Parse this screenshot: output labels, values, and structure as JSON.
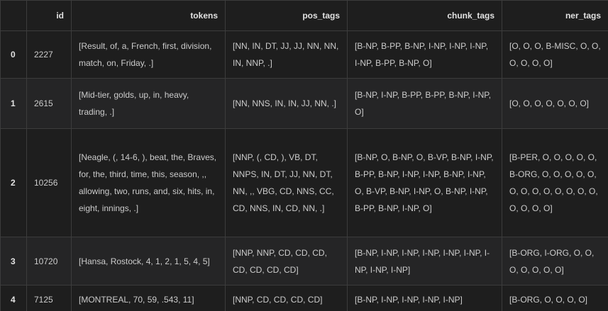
{
  "table": {
    "columns": [
      "",
      "id",
      "tokens",
      "pos_tags",
      "chunk_tags",
      "ner_tags"
    ],
    "rows": [
      {
        "index": "0",
        "id": "2227",
        "tokens": "[Result, of, a, French, first, division, match, on, Friday, .]",
        "pos_tags": "[NN, IN, DT, JJ, JJ, NN, NN, IN, NNP, .]",
        "chunk_tags": "[B-NP, B-PP, B-NP, I-NP, I-NP, I-NP, I-NP, B-PP, B-NP, O]",
        "ner_tags": "[O, O, O, B-MISC, O, O, O, O, O, O]"
      },
      {
        "index": "1",
        "id": "2615",
        "tokens": "[Mid-tier, golds, up, in, heavy, trading, .]",
        "pos_tags": "[NN, NNS, IN, IN, JJ, NN, .]",
        "chunk_tags": "[B-NP, I-NP, B-PP, B-PP, B-NP, I-NP, O]",
        "ner_tags": "[O, O, O, O, O, O, O]"
      },
      {
        "index": "2",
        "id": "10256",
        "tokens": "[Neagle, (, 14-6, ), beat, the, Braves, for, the, third, time, this, season, ,, allowing, two, runs, and, six, hits, in, eight, innings, .]",
        "pos_tags": "[NNP, (, CD, ), VB, DT, NNPS, IN, DT, JJ, NN, DT, NN, ,, VBG, CD, NNS, CC, CD, NNS, IN, CD, NN, .]",
        "chunk_tags": "[B-NP, O, B-NP, O, B-VP, B-NP, I-NP, B-PP, B-NP, I-NP, I-NP, B-NP, I-NP, O, B-VP, B-NP, I-NP, O, B-NP, I-NP, B-PP, B-NP, I-NP, O]",
        "ner_tags": "[B-PER, O, O, O, O, O, B-ORG, O, O, O, O, O, O, O, O, O, O, O, O, O, O, O, O, O]"
      },
      {
        "index": "3",
        "id": "10720",
        "tokens": "[Hansa, Rostock, 4, 1, 2, 1, 5, 4, 5]",
        "pos_tags": "[NNP, NNP, CD, CD, CD, CD, CD, CD, CD]",
        "chunk_tags": "[B-NP, I-NP, I-NP, I-NP, I-NP, I-NP, I-NP, I-NP, I-NP]",
        "ner_tags": "[B-ORG, I-ORG, O, O, O, O, O, O, O]"
      },
      {
        "index": "4",
        "id": "7125",
        "tokens": "[MONTREAL, 70, 59, .543, 11]",
        "pos_tags": "[NNP, CD, CD, CD, CD]",
        "chunk_tags": "[B-NP, I-NP, I-NP, I-NP, I-NP]",
        "ner_tags": "[B-ORG, O, O, O, O]"
      }
    ]
  }
}
